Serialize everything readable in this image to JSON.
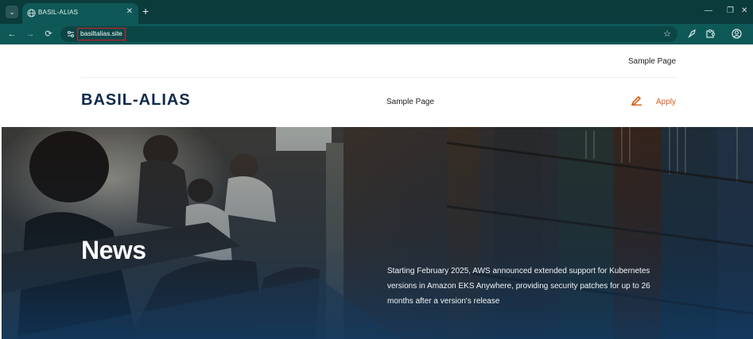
{
  "browser": {
    "tab": {
      "title": "BASIL-ALIAS",
      "close_glyph": "✕"
    },
    "new_tab_glyph": "+",
    "tab_menu_glyph": "⌄",
    "window_controls": {
      "minimize": "—",
      "restore": "❐",
      "close": "✕"
    },
    "nav": {
      "back": "←",
      "forward": "→",
      "reload": "⟳"
    },
    "address": {
      "url": "basiltalias.site"
    },
    "star_glyph": "☆",
    "icons": [
      "extensions-icon",
      "puzzle-icon",
      "profile-icon"
    ],
    "colors": {
      "tabstrip": "#0b3b3b",
      "toolbar": "#0f5858",
      "url_highlight": "#d61d2a"
    }
  },
  "page": {
    "topnav": {
      "link": "Sample Page"
    },
    "header": {
      "brand": "BASIL-ALIAS",
      "nav_link": "Sample Page",
      "apply_label": "Apply",
      "colors": {
        "brand": "#0d2a4a",
        "apply": "#d65f1b"
      }
    },
    "hero": {
      "title": "News",
      "text": "Starting February 2025, AWS announced extended support for Kubernetes versions in Amazon EKS Anywhere, providing security patches for up to 26 months after a version's release"
    }
  }
}
